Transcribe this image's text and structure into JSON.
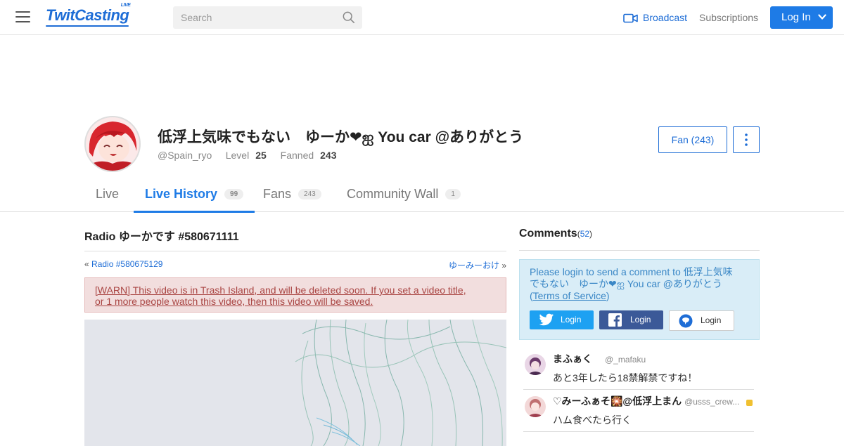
{
  "header": {
    "logo_text": "TwitCasting",
    "logo_live": "LIVE",
    "search_placeholder": "Search",
    "broadcast_label": "Broadcast",
    "subscriptions_label": "Subscriptions",
    "login_label": "Log In",
    "accent_color": "#1e7be6"
  },
  "profile": {
    "title": "低浮上気味でもない　ゆーか❤ஐ You car @ありがとう",
    "handle": "@Spain_ryo",
    "level_label": "Level",
    "level_value": "25",
    "fanned_label": "Fanned",
    "fanned_value": "243",
    "fan_button": "Fan (243)"
  },
  "tabs": [
    {
      "label": "Live",
      "badge": ""
    },
    {
      "label": "Live History",
      "badge": "99",
      "active": true
    },
    {
      "label": "Fans",
      "badge": "243"
    },
    {
      "label": "Community Wall",
      "badge": "1"
    }
  ],
  "movie": {
    "title": "Radio ゆーかです #580671111",
    "prev_prefix": "«",
    "prev_link": "Radio #580675129",
    "next_link": "ゆーみーおけ",
    "next_suffix": "»",
    "warning": "[WARN] This video is in Trash Island, and will be deleted soon. If you set a video title, or 1 more people watch this video, then this video will be saved."
  },
  "comments_panel": {
    "heading": "Comments",
    "count_open": "(",
    "count": "52",
    "count_close": ")",
    "login_message": "Please login to send a comment to 低浮上気味でもない　ゆーか❤ஐ You car @ありがとう",
    "tos_open": "(",
    "tos_link": "Terms of Service",
    "tos_close": ")",
    "twitter_login": "Login",
    "facebook_login": "Login",
    "twitcas_login": "Login",
    "items": [
      {
        "name": "まふぁく　",
        "id": "@_mafaku",
        "text": "あと3年したら18禁解禁ですね！"
      },
      {
        "name": "♡みーふぁそ🎇@低浮上まん",
        "id": "@usss_crew...",
        "text": "ハム食べたら行く"
      }
    ]
  }
}
